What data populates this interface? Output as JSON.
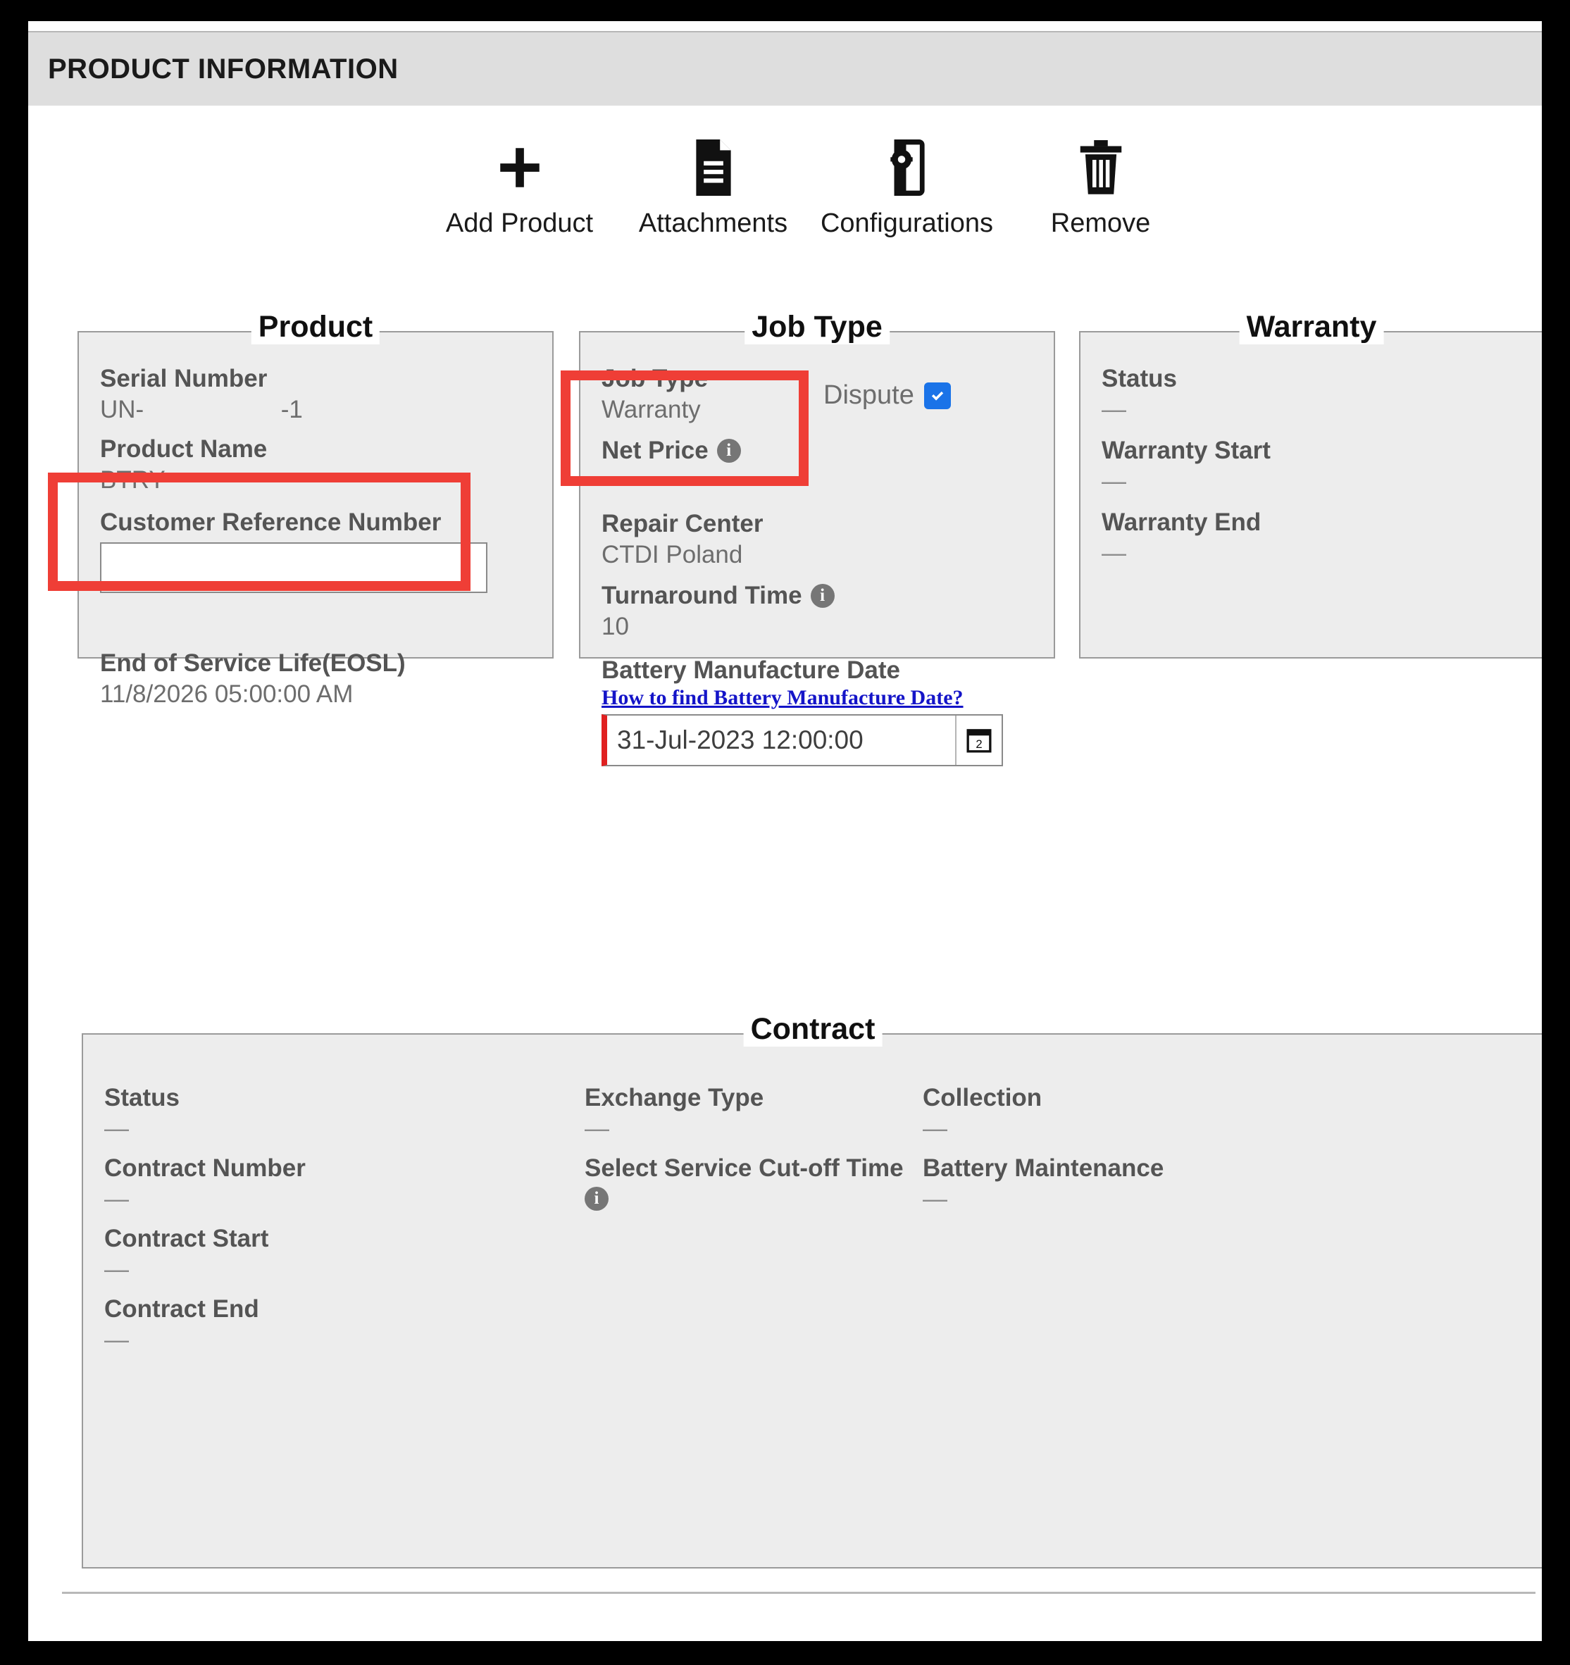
{
  "header": {
    "title": "PRODUCT INFORMATION"
  },
  "toolbar": {
    "items": [
      {
        "label": "Add Product",
        "icon": "plus-icon"
      },
      {
        "label": "Attachments",
        "icon": "document-icon"
      },
      {
        "label": "Configurations",
        "icon": "device-gear-icon"
      },
      {
        "label": "Remove",
        "icon": "trash-icon"
      }
    ]
  },
  "product": {
    "legend": "Product",
    "serial_number_label": "Serial Number",
    "serial_number_value": "UN-                    -1",
    "product_name_label": "Product Name",
    "product_name_value": "BTRY-",
    "customer_reference_label": "Customer Reference Number",
    "customer_reference_value": "",
    "customer_reference_placeholder": "",
    "eosl_label": "End of Service Life(EOSL)",
    "eosl_value": "11/8/2026 05:00:00 AM"
  },
  "job_type": {
    "legend": "Job Type",
    "job_type_label": "Job Type",
    "job_type_value": "Warranty",
    "dispute_label": "Dispute",
    "dispute_checked": true,
    "net_price_label": "Net Price",
    "net_price_value": "—",
    "repair_center_label": "Repair Center",
    "repair_center_value": "CTDI Poland",
    "turnaround_time_label": "Turnaround Time",
    "turnaround_time_value": "10",
    "battery_date_label": "Battery Manufacture Date",
    "battery_date_help_link": "How to find Battery Manufacture Date?",
    "battery_date_value": "31-Jul-2023 12:00:00",
    "battery_date_placeholder": ""
  },
  "warranty": {
    "legend": "Warranty",
    "status_label": "Status",
    "status_value": "—",
    "start_label": "Warranty Start",
    "start_value": "—",
    "end_label": "Warranty End",
    "end_value": "—"
  },
  "contract": {
    "legend": "Contract",
    "status_label": "Status",
    "status_value": "—",
    "contract_number_label": "Contract Number",
    "contract_number_value": "—",
    "contract_start_label": "Contract Start",
    "contract_start_value": "—",
    "contract_end_label": "Contract End",
    "contract_end_value": "—",
    "exchange_type_label": "Exchange Type",
    "exchange_type_value": "—",
    "cutoff_label": "Select Service Cut-off Time",
    "collection_label": "Collection",
    "collection_value": "—",
    "battery_maintenance_label": "Battery Maintenance",
    "battery_maintenance_value": "—"
  },
  "colors": {
    "accent_red": "#EF3E36",
    "checkbox_blue": "#1A73E8",
    "link_blue": "#1414C8",
    "panel_bg": "#EDEDED",
    "header_bg": "#DEDEDE"
  }
}
